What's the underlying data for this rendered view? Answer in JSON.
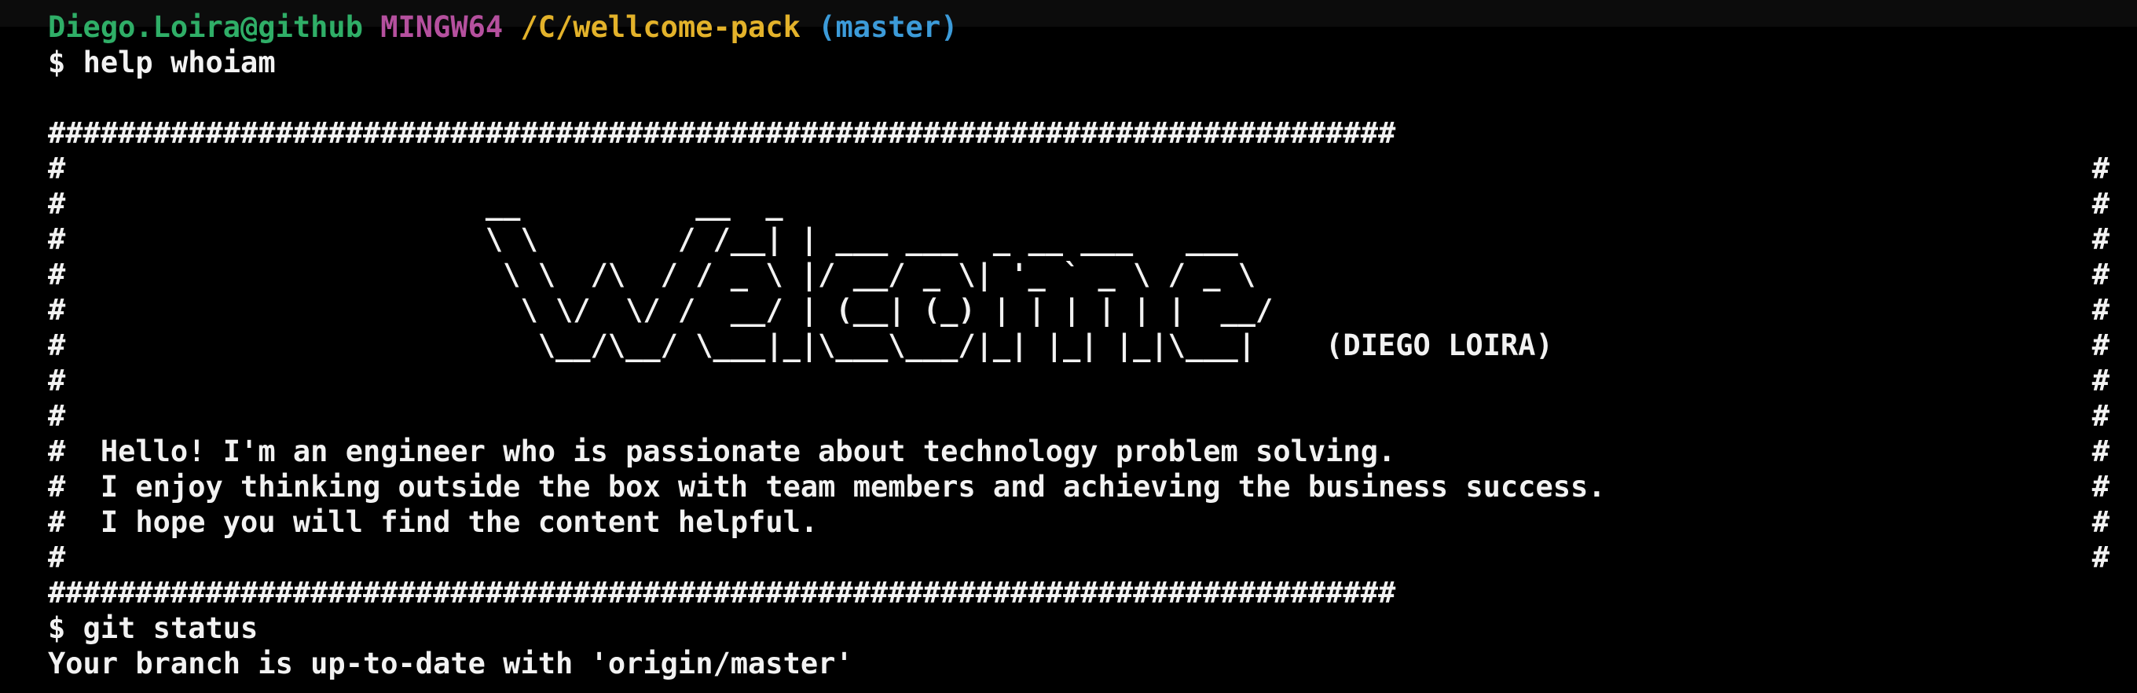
{
  "prompt": {
    "user": "Diego.Loira@github",
    "system": "MINGW64",
    "path": "/C/wellcome-pack",
    "branch": "(master)",
    "symbol": "$"
  },
  "colors": {
    "user": "#2fae67",
    "system": "#b5509e",
    "path": "#e3b22a",
    "branch": "#3c9bd9",
    "text": "#f2f2f2",
    "background": "#000000"
  },
  "commands": {
    "first": "help whoiam",
    "second": "git status"
  },
  "banner": {
    "border": "#############################################################################",
    "edge": "#",
    "ascii_art": [
      "",
      "                        __          __  _",
      "                        \\ \\        / /__| | ___ ___  _ __ ___   ___",
      "                         \\ \\  /\\  / / _ \\ |/ __/ _ \\| '_ ` _ \\ / _ \\",
      "                          \\ \\/  \\/ /  __/ | (__| (_) | | | | | |  __/",
      "                           \\__/\\__/ \\___|_|\\___\\___/|_| |_| |_|\\___|    (DIEGO LOIRA)",
      "",
      ""
    ],
    "messages": [
      "  Hello! I'm an engineer who is passionate about technology problem solving.",
      "  I enjoy thinking outside the box with team members and achieving the business success.",
      "  I hope you will find the content helpful.",
      ""
    ]
  },
  "output": {
    "git_status": "Your branch is up-to-date with 'origin/master'"
  }
}
